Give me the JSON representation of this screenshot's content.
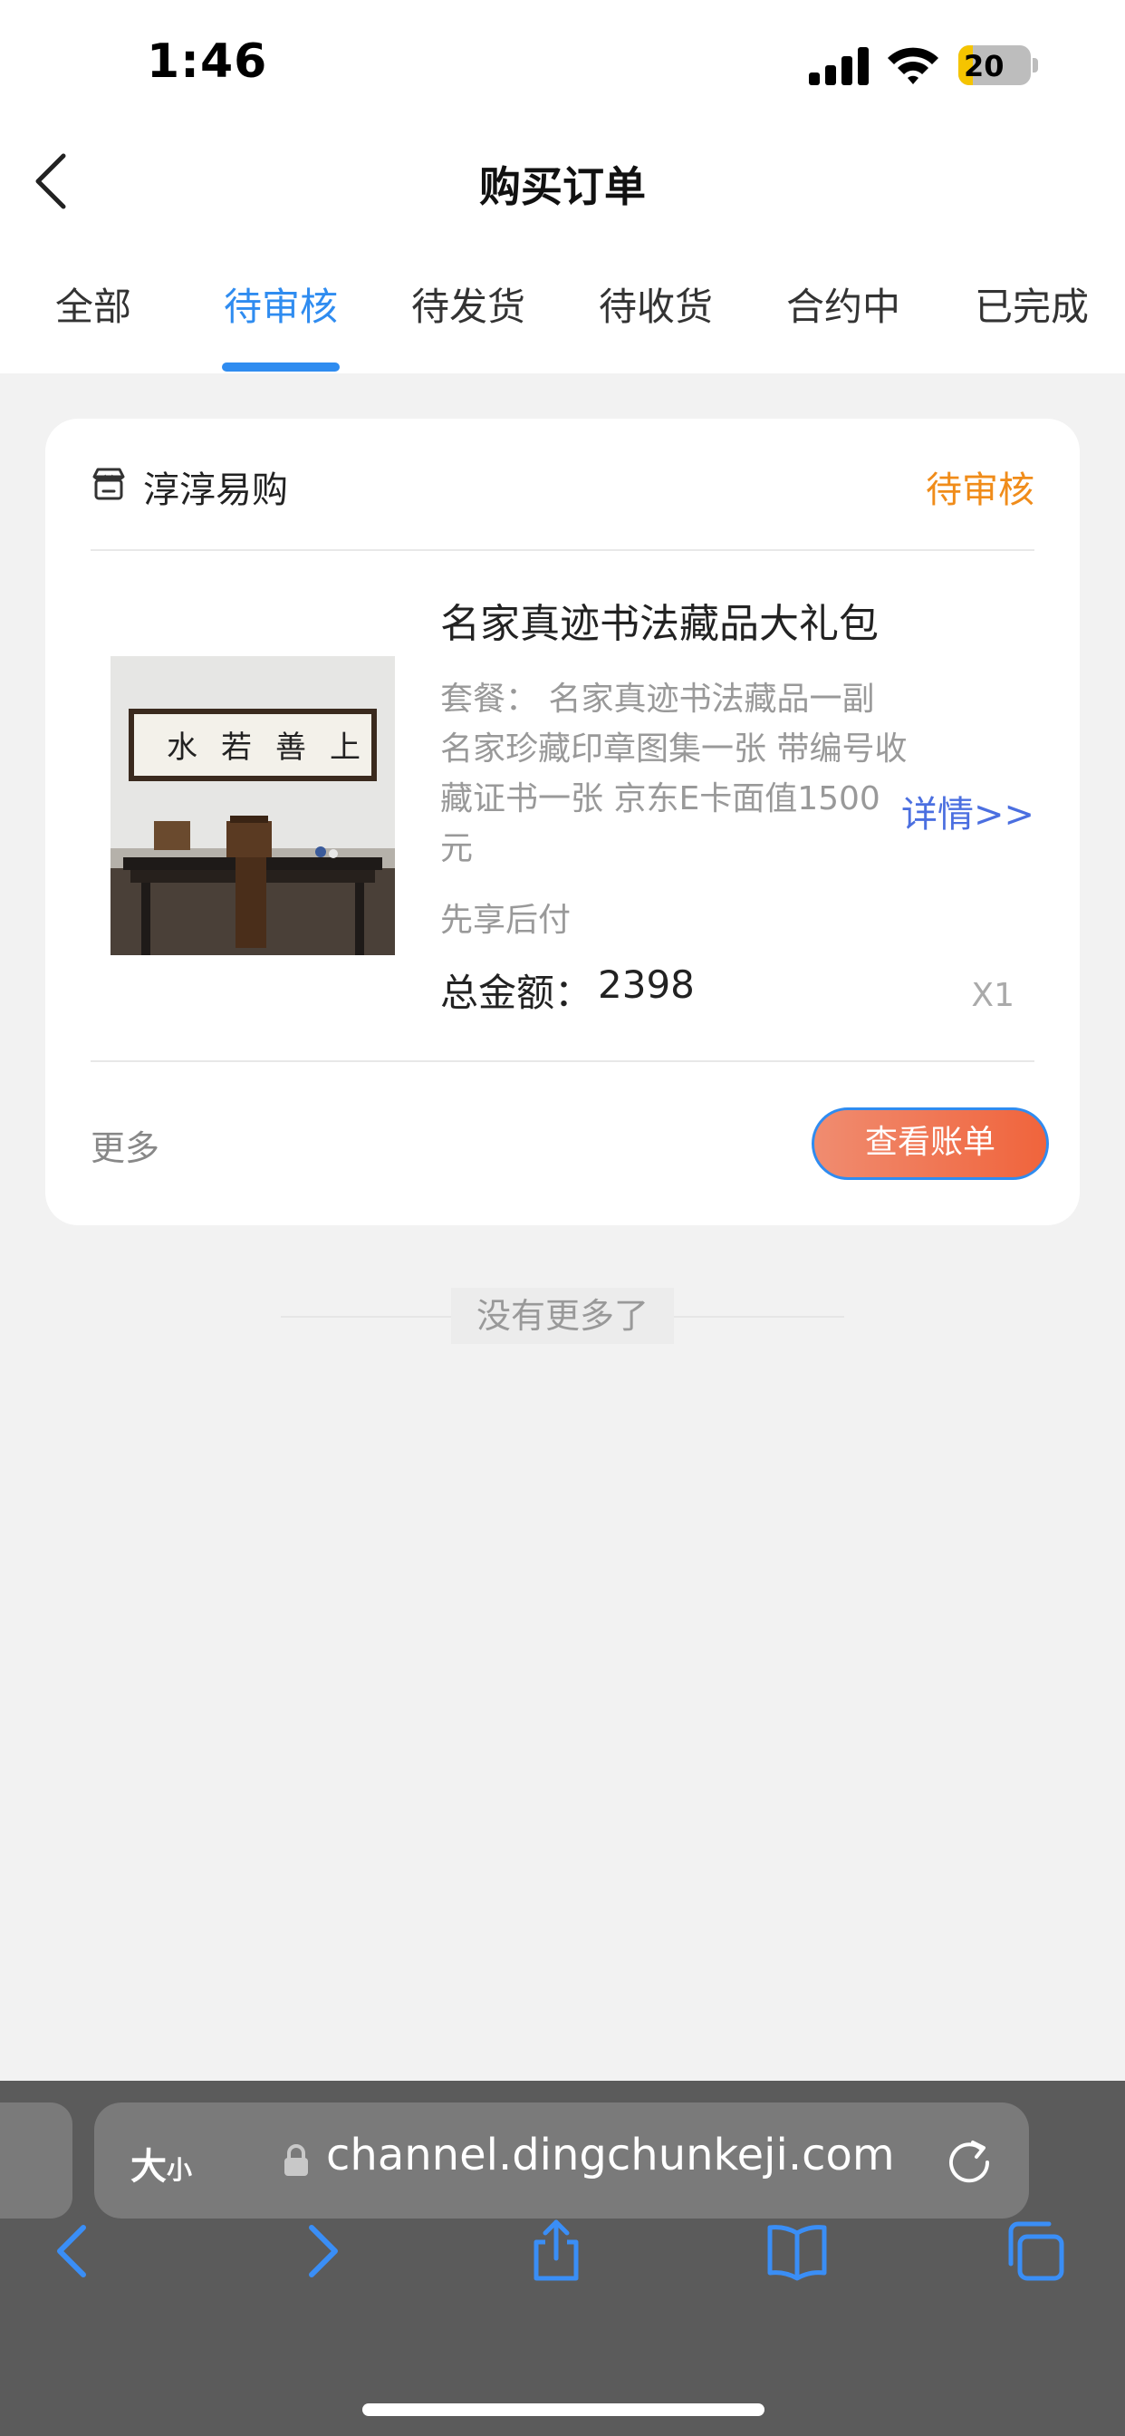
{
  "status_bar": {
    "time": "1:46",
    "battery": "20",
    "battery_level": 0.2,
    "battery_color": "#f5c400"
  },
  "nav": {
    "title": "购买订单"
  },
  "tabs": [
    {
      "label": "全部"
    },
    {
      "label": "待审核"
    },
    {
      "label": "待发货"
    },
    {
      "label": "待收货"
    },
    {
      "label": "合约中"
    },
    {
      "label": "已完成"
    }
  ],
  "active_tab": "待审核",
  "order": {
    "shop_icon": "shop-icon",
    "shop_name": "淳淳易购",
    "status": "待审核",
    "product_title": "名家真迹书法藏品大礼包",
    "package_label": "套餐：",
    "package_detail": "名家真迹书法藏品一副 名家珍藏印章图集一张 带编号收藏证书一张 京东E卡面值1500元",
    "payment_note": "先享后付",
    "total_label": "总金额：",
    "total_value": "2398",
    "details_link": "详情>>",
    "quantity": "X1",
    "more_label": "更多",
    "view_bill_label": "查看账单",
    "image": {
      "calligraphy_characters": [
        "上",
        "善",
        "若",
        "水"
      ]
    }
  },
  "footer_note": "没有更多了",
  "browser": {
    "text_size_big": "大",
    "text_size_small": "小",
    "url": "channel.dingchunkeji.com",
    "icons": [
      "lock-icon",
      "reload-icon",
      "back-icon",
      "forward-icon",
      "share-icon",
      "bookmarks-icon",
      "tabs-icon"
    ]
  },
  "colors": {
    "accent_blue": "#2f8cf0",
    "status_orange": "#f08c1a",
    "link_blue": "#4b6fe0",
    "button_gradient_start": "#f08c70",
    "button_gradient_end": "#f0643c"
  }
}
